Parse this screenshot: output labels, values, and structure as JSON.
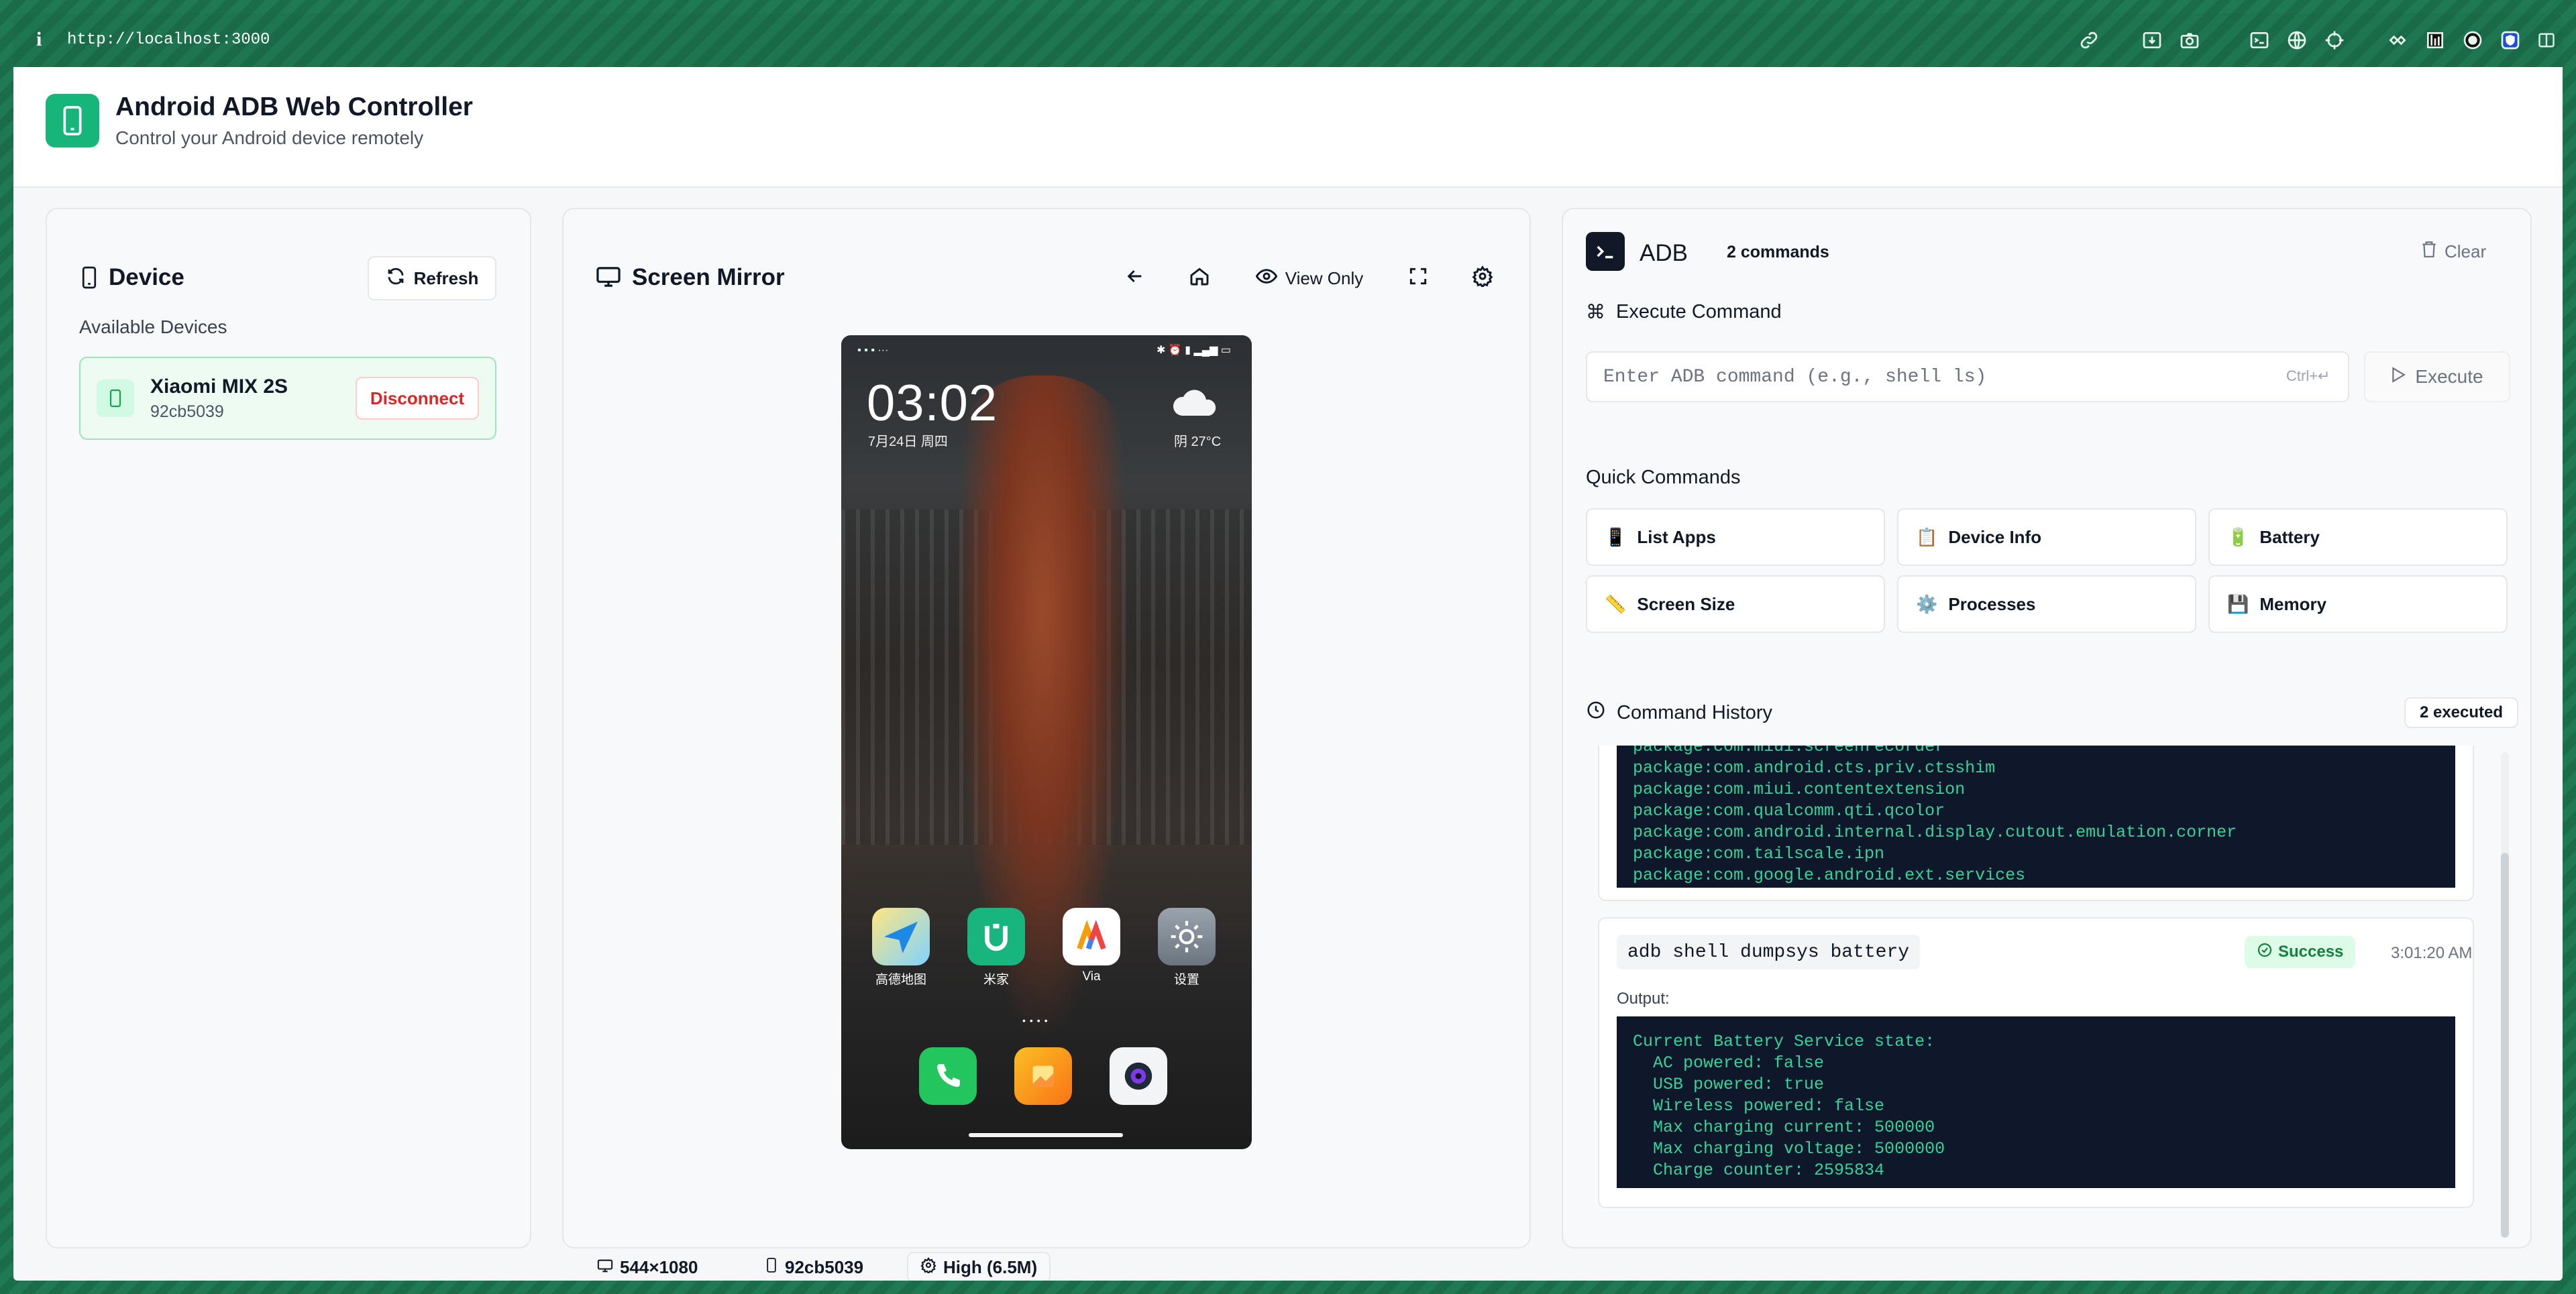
{
  "browser": {
    "info_icon": "i",
    "url": "http://localhost:3000",
    "toolbar_icons": [
      "link-icon",
      "install-icon",
      "camera-icon",
      "terminal-icon",
      "globe-icon",
      "crosshair-icon",
      "extension-icon",
      "bookmark-icon",
      "record-icon",
      "shield-icon",
      "sidebar-icon"
    ]
  },
  "app": {
    "title": "Android ADB Web Controller",
    "subtitle": "Control your Android device remotely",
    "brand_color": "#16b57a"
  },
  "device_panel": {
    "title": "Device",
    "refresh_label": "Refresh",
    "available_label": "Available Devices",
    "device": {
      "name": "Xiaomi MIX 2S",
      "serial": "92cb5039",
      "disconnect_label": "Disconnect"
    }
  },
  "mirror_panel": {
    "title": "Screen Mirror",
    "view_only_label": "View Only",
    "phone": {
      "time": "03:02",
      "date": "7月24日 周四",
      "weather": "阴  27°C",
      "apps": [
        {
          "label": "高德地图",
          "icon": "map-app-icon"
        },
        {
          "label": "米家",
          "icon": "mijia-app-icon"
        },
        {
          "label": "Via",
          "icon": "via-browser-icon"
        },
        {
          "label": "设置",
          "icon": "settings-app-icon"
        }
      ],
      "dock": [
        "phone-app-icon",
        "gallery-app-icon",
        "camera-app-icon"
      ]
    },
    "stats": {
      "resolution": "544×1080",
      "serial": "92cb5039",
      "quality": "High (6.5M)"
    }
  },
  "adb_panel": {
    "title": "ADB",
    "count": "2 commands",
    "clear_label": "Clear",
    "execute_title": "Execute Command",
    "input_placeholder": "Enter ADB command (e.g., shell ls)",
    "shortcut": "Ctrl+↵",
    "execute_label": "Execute",
    "quick_title": "Quick Commands",
    "quick": [
      {
        "emoji": "📱",
        "label": "List Apps"
      },
      {
        "emoji": "📋",
        "label": "Device Info"
      },
      {
        "emoji": "🔋",
        "label": "Battery"
      },
      {
        "emoji": "📏",
        "label": "Screen Size"
      },
      {
        "emoji": "⚙️",
        "label": "Processes"
      },
      {
        "emoji": "💾",
        "label": "Memory"
      }
    ],
    "history_title": "Command History",
    "history_badge": "2 executed",
    "history": [
      {
        "output": "package:com.miui.screenrecorder\npackage:com.android.cts.priv.ctsshim\npackage:com.miui.contentextension\npackage:com.qualcomm.qti.qcolor\npackage:com.android.internal.display.cutout.emulation.corner\npackage:com.tailscale.ipn\npackage:com.google.android.ext.services"
      },
      {
        "command": "adb shell dumpsys battery",
        "status": "Success",
        "time": "3:01:20 AM",
        "output_label": "Output:",
        "output": "Current Battery Service state:\n  AC powered: false\n  USB powered: true\n  Wireless powered: false\n  Max charging current: 500000\n  Max charging voltage: 5000000\n  Charge counter: 2595834"
      }
    ]
  }
}
